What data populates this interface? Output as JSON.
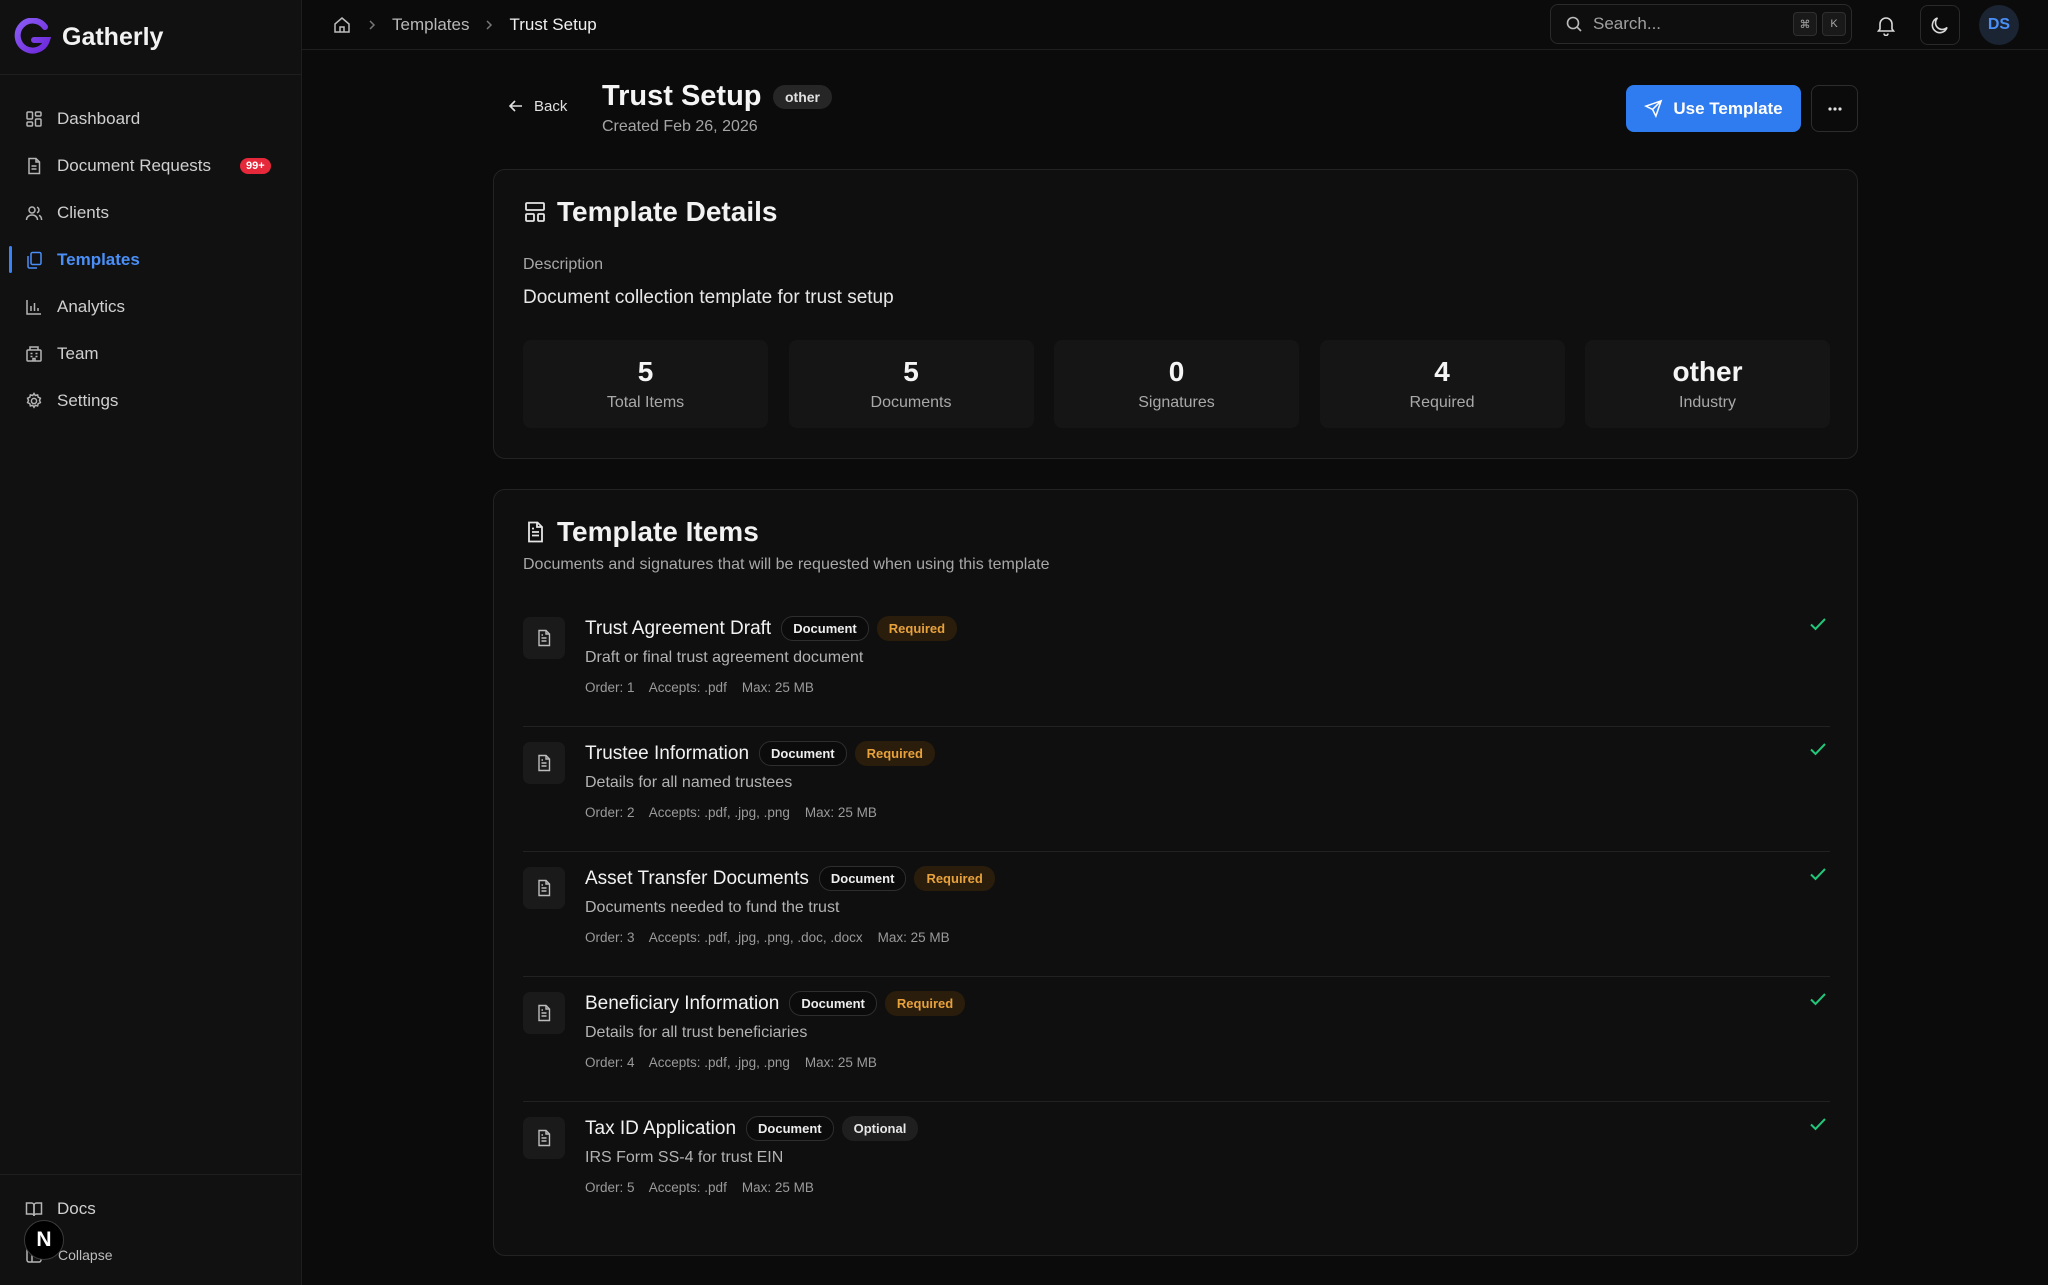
{
  "brand": {
    "name": "Gatherly"
  },
  "sidebar": {
    "items": [
      {
        "label": "Dashboard",
        "icon": "dashboard-icon"
      },
      {
        "label": "Document Requests",
        "icon": "document-icon",
        "badge": "99+"
      },
      {
        "label": "Clients",
        "icon": "users-icon"
      },
      {
        "label": "Templates",
        "icon": "copy-icon",
        "active": true
      },
      {
        "label": "Analytics",
        "icon": "bar-chart-icon"
      },
      {
        "label": "Team",
        "icon": "building-icon"
      },
      {
        "label": "Settings",
        "icon": "gear-icon"
      }
    ],
    "docs_label": "Docs",
    "collapse_label": "Collapse",
    "user_initial": "N"
  },
  "topbar": {
    "breadcrumb": [
      "Templates",
      "Trust Setup"
    ],
    "search_placeholder": "Search...",
    "shortcut_keys": [
      "⌘",
      "K"
    ],
    "avatar_initials": "DS"
  },
  "header": {
    "back_label": "Back",
    "title": "Trust Setup",
    "industry_badge": "other",
    "created": "Created Feb 26, 2026",
    "use_template_label": "Use Template",
    "more_label": "···"
  },
  "details": {
    "title": "Template Details",
    "description_label": "Description",
    "description": "Document collection template for trust setup",
    "stats": [
      {
        "value": "5",
        "label": "Total Items"
      },
      {
        "value": "5",
        "label": "Documents"
      },
      {
        "value": "0",
        "label": "Signatures"
      },
      {
        "value": "4",
        "label": "Required"
      },
      {
        "value": "other",
        "label": "Industry"
      }
    ]
  },
  "items_section": {
    "title": "Template Items",
    "subtitle": "Documents and signatures that will be requested when using this template",
    "items": [
      {
        "name": "Trust Agreement Draft",
        "type": "Document",
        "status": "Required",
        "description": "Draft or final trust agreement document",
        "meta": "Order: 1    Accepts: .pdf    Max: 25 MB"
      },
      {
        "name": "Trustee Information",
        "type": "Document",
        "status": "Required",
        "description": "Details for all named trustees",
        "meta": "Order: 2    Accepts: .pdf, .jpg, .png    Max: 25 MB"
      },
      {
        "name": "Asset Transfer Documents",
        "type": "Document",
        "status": "Required",
        "description": "Documents needed to fund the trust",
        "meta": "Order: 3    Accepts: .pdf, .jpg, .png, .doc, .docx    Max: 25 MB"
      },
      {
        "name": "Beneficiary Information",
        "type": "Document",
        "status": "Required",
        "description": "Details for all trust beneficiaries",
        "meta": "Order: 4    Accepts: .pdf, .jpg, .png    Max: 25 MB"
      },
      {
        "name": "Tax ID Application",
        "type": "Document",
        "status": "Optional",
        "description": "IRS Form SS-4 for trust EIN",
        "meta": "Order: 5    Accepts: .pdf    Max: 25 MB"
      }
    ]
  },
  "colors": {
    "accent": "#2f7bf0",
    "required": "#e8a23c",
    "check": "#22c77a",
    "badge": "#e5283a",
    "brand": "#7c3aed"
  }
}
